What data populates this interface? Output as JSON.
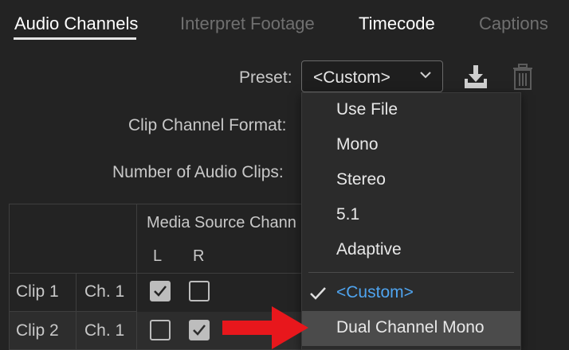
{
  "tabs": {
    "audio_channels": "Audio Channels",
    "interpret_footage": "Interpret Footage",
    "timecode": "Timecode",
    "captions": "Captions"
  },
  "form": {
    "preset_label": "Preset:",
    "preset_value": "<Custom>",
    "clip_channel_format_label": "Clip Channel Format:",
    "number_of_audio_clips_label": "Number of Audio Clips:"
  },
  "grid": {
    "media_source_header": "Media Source Chann",
    "left_label": "L",
    "right_label": "R",
    "rows": [
      {
        "clip": "Clip 1",
        "channel": "Ch. 1",
        "left_checked": true,
        "right_checked": false
      },
      {
        "clip": "Clip 2",
        "channel": "Ch. 1",
        "left_checked": false,
        "right_checked": true
      }
    ]
  },
  "dropdown": {
    "items": [
      "Use File",
      "Mono",
      "Stereo",
      "5.1",
      "Adaptive"
    ],
    "custom": "<Custom>",
    "dual_channel_mono": "Dual Channel Mono"
  },
  "icons": {
    "save_preset": "download-icon",
    "delete_preset": "trash-icon",
    "pointer": "red-arrow-icon"
  },
  "colors": {
    "accent": "#4fa4ef",
    "arrow": "#e8171c",
    "background": "#232323"
  }
}
